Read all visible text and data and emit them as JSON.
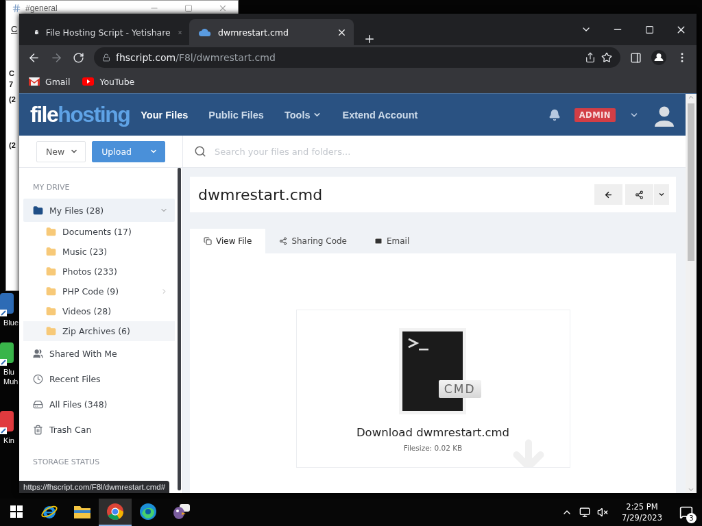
{
  "background_window": {
    "title": "#general",
    "menu_fragment": "C",
    "fragments": [
      "C",
      "7",
      "(2",
      "(2"
    ]
  },
  "desktop_icons": [
    {
      "kind": "app",
      "lines": [
        "Blue"
      ]
    },
    {
      "kind": "green",
      "lines": [
        "Blu",
        "Muh"
      ]
    },
    {
      "kind": "red",
      "lines": [
        "Kin"
      ]
    }
  ],
  "browser": {
    "tabs": [
      {
        "title": "File Hosting Script - Yetishare",
        "selected": false
      },
      {
        "title": "dwmrestart.cmd",
        "selected": true
      }
    ],
    "address": {
      "host": "fhscript.com",
      "path": "/F8l/dwmrestart.cmd"
    },
    "bookmarks": [
      {
        "kind": "gmail",
        "label": "Gmail"
      },
      {
        "kind": "youtube",
        "label": "YouTube"
      }
    ],
    "status_url": "https://fhscript.com/F8l/dwmrestart.cmd#"
  },
  "site": {
    "logo": {
      "first": "file",
      "second": "hosting"
    },
    "nav": [
      {
        "label": "Your Files",
        "selected": true,
        "dropdown": false
      },
      {
        "label": "Public Files",
        "selected": false,
        "dropdown": false
      },
      {
        "label": "Tools",
        "selected": false,
        "dropdown": true
      },
      {
        "label": "Extend Account",
        "selected": false,
        "dropdown": false
      }
    ],
    "badge": "ADMIN"
  },
  "sidebar": {
    "buttons": [
      {
        "kind": "default",
        "label": "New"
      },
      {
        "kind": "primary",
        "label": "Upload"
      }
    ],
    "section": "MY DRIVE",
    "items": [
      {
        "kind": "folder",
        "label": "My Files (28)",
        "selected": true,
        "expanded": true,
        "children": [
          {
            "label": "Documents (17)",
            "hovered": false,
            "has_children": false
          },
          {
            "label": "Music (23)",
            "hovered": false,
            "has_children": false
          },
          {
            "label": "Photos (233)",
            "hovered": false,
            "has_children": false
          },
          {
            "label": "PHP Code (9)",
            "hovered": false,
            "has_children": true
          },
          {
            "label": "Videos (28)",
            "hovered": false,
            "has_children": false
          },
          {
            "label": "Zip Archives (6)",
            "hovered": true,
            "has_children": false
          }
        ]
      },
      {
        "kind": "shared",
        "label": "Shared With Me",
        "selected": false
      },
      {
        "kind": "recent",
        "label": "Recent Files",
        "selected": false
      },
      {
        "kind": "all",
        "label": "All Files (348)",
        "selected": false
      },
      {
        "kind": "trash",
        "label": "Trash Can",
        "selected": false
      }
    ],
    "footer_section": "STORAGE STATUS"
  },
  "search": {
    "placeholder": "Search your files and folders..."
  },
  "file": {
    "title": "dwmrestart.cmd",
    "tabs": [
      {
        "kind": "view",
        "label": "View File",
        "selected": true
      },
      {
        "kind": "share",
        "label": "Sharing Code",
        "selected": false
      },
      {
        "kind": "email",
        "label": "Email",
        "selected": false
      }
    ],
    "type_label": "CMD",
    "download": "Download dwmrestart.cmd",
    "filesize": "Filesize: 0.02 KB"
  },
  "taskbar": {
    "apps": [
      {
        "kind": "ie",
        "selected": false
      },
      {
        "kind": "explorer",
        "selected": false
      },
      {
        "kind": "chrome",
        "selected": true
      },
      {
        "kind": "edge",
        "selected": false
      },
      {
        "kind": "pidgin",
        "selected": false
      }
    ],
    "time": "2:25 PM",
    "date": "7/29/2023",
    "notifications": "3"
  }
}
